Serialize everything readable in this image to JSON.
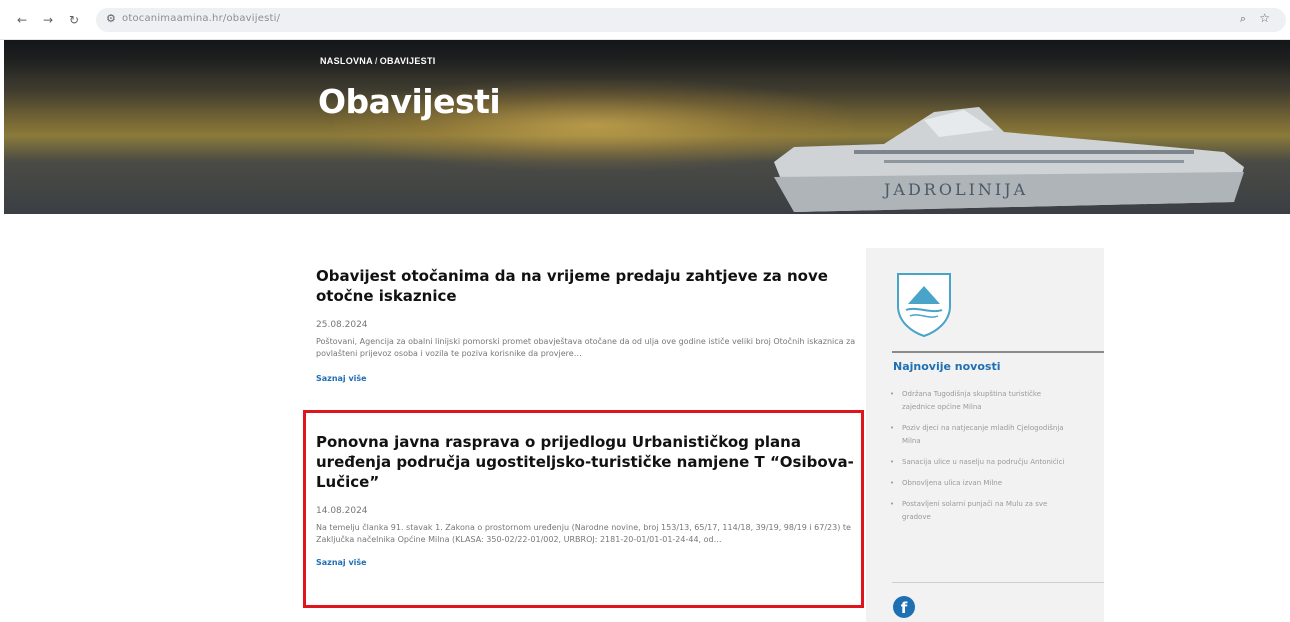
{
  "browser": {
    "url": "otocanimaamina.hr/obavijesti/"
  },
  "hero": {
    "breadcrumb": [
      "NASLOVNA",
      "OBAVIJESTI"
    ],
    "title": "Obavijesti",
    "ship_text": "JADROLINIJA"
  },
  "articles": [
    {
      "title": "Obavijest otočanima da na vrijeme predaju zahtjeve za nove otočne iskaznice",
      "date": "25.08.2024",
      "excerpt": "Poštovani, Agencija za obalni linijski pomorski promet obavještava otočane da od ulja ove godine ističe veliki broj Otočnih iskaznica za povlašteni prijevoz osoba i vozila te poziva korisnike da provjere…",
      "more": "Saznaj više"
    },
    {
      "title": "Ponovna javna rasprava o prijedlogu Urbanističkog plana uređenja područja ugostiteljsko-turističke namjene T “Osibova-Lučice”",
      "date": "14.08.2024",
      "excerpt": "Na temelju članka 91. stavak 1. Zakona o prostornom uređenju (Narodne novine, broj 153/13, 65/17, 114/18, 39/19, 98/19 i 67/23) te Zaključka načelnika Općine Milna (KLASA: 350-02/22-01/002, URBROJ: 2181-20-01/01-01-24-44, od…",
      "more": "Saznaj više"
    }
  ],
  "sidebar": {
    "heading": "Najnovije novosti",
    "news": [
      "Održana Tugodišnja skupština turističke zajednice općine Milna",
      "Poziv djeci na natjecanje mladih Cjelogodišnja Milna",
      "Sanacija ulice u naselju na području Antonićici",
      "Obnovljena ulica izvan Milne",
      "Postavljeni solarni punjači na Mulu za sve gradove"
    ],
    "social_icon": "facebook-icon"
  },
  "colors": {
    "accent": "#1f6fb3",
    "highlight": "#e0151b"
  }
}
